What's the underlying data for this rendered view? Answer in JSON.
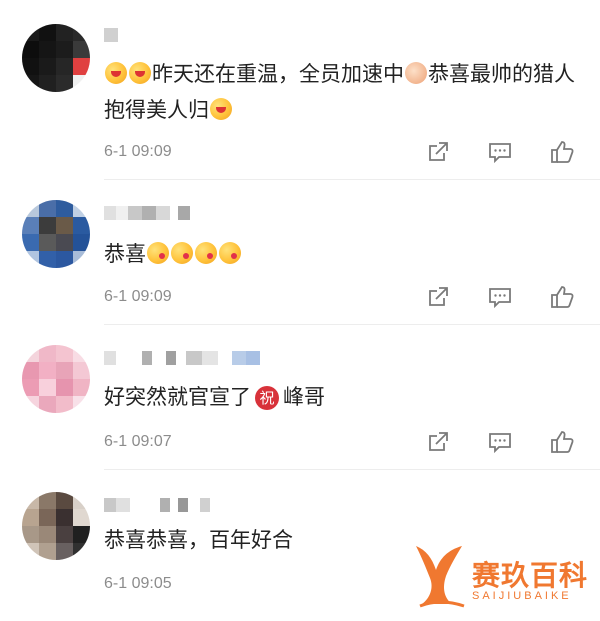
{
  "comments": [
    {
      "text_a": "昨天还在重温，全员加速中",
      "text_b": "恭喜最帅的猎人抱得美人归",
      "time": "6-1 09:09"
    },
    {
      "text_a": "恭喜",
      "time": "6-1 09:09"
    },
    {
      "text_a": "好突然就官宣了",
      "badge": "祝",
      "text_b": "峰哥",
      "time": "6-1 09:07"
    },
    {
      "text_a": "恭喜恭喜，百年好合",
      "time": "6-1 09:05"
    }
  ],
  "watermark": {
    "title": "赛玖百科",
    "subtitle": "SAIJIUBAIKE"
  },
  "colors": {
    "time": "#8c8c8c",
    "icon": "#7a7a7a",
    "badge": "#d8323a",
    "watermark": "#f07830"
  },
  "icons": [
    "share-icon",
    "comment-icon",
    "like-icon"
  ]
}
